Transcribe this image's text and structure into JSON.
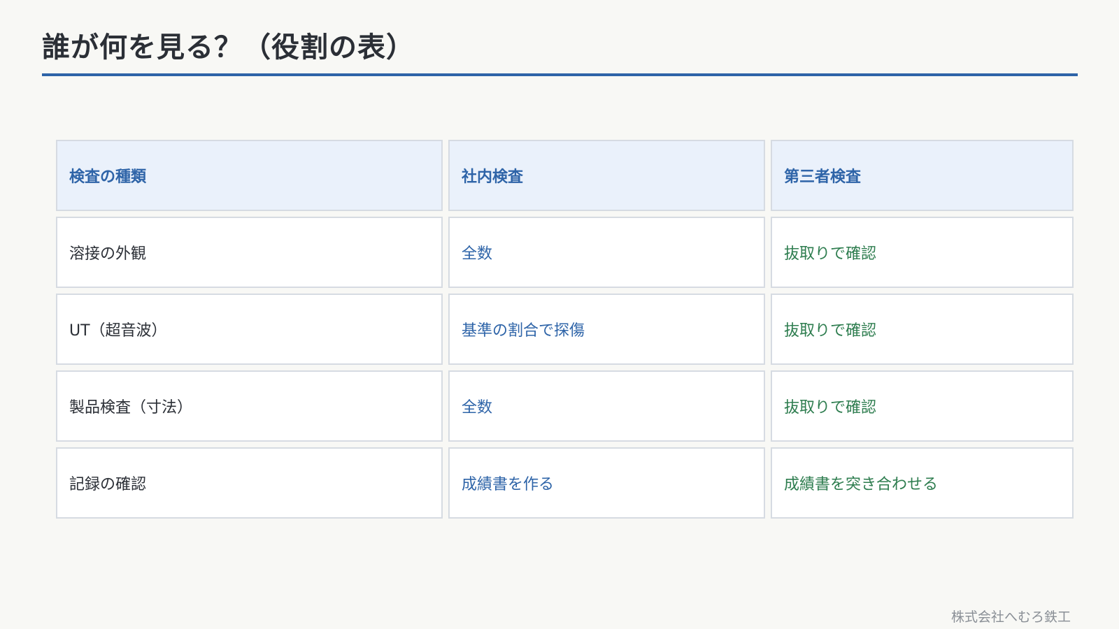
{
  "slide": {
    "title": "誰が何を見る？（役割の表）",
    "footer": "株式会社へむろ鉄工"
  },
  "table": {
    "headers": [
      "検査の種類",
      "社内検査",
      "第三者検査"
    ],
    "rows": [
      [
        "溶接の外観",
        "全数",
        "抜取りで確認"
      ],
      [
        "UT（超音波）",
        "基準の割合で探傷",
        "抜取りで確認"
      ],
      [
        "製品検査（寸法）",
        "全数",
        "抜取りで確認"
      ],
      [
        "記録の確認",
        "成績書を作る",
        "成績書を突き合わせる"
      ]
    ]
  },
  "colors": {
    "accent": "#2e64a8",
    "third_party_text": "#2e7d4f",
    "header_bg": "#eaf1fb",
    "page_bg": "#f8f8f5"
  }
}
